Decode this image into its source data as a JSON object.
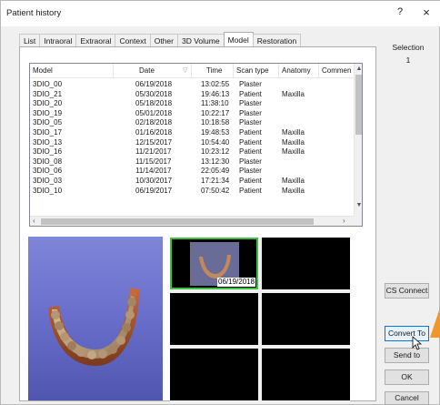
{
  "window": {
    "title": "Patient history",
    "help": "?",
    "close": "×"
  },
  "tabs": [
    {
      "label": "List"
    },
    {
      "label": "Intraoral"
    },
    {
      "label": "Extraoral"
    },
    {
      "label": "Context"
    },
    {
      "label": "Other"
    },
    {
      "label": "3D Volume"
    },
    {
      "label": "Model",
      "active": true
    },
    {
      "label": "Restoration"
    }
  ],
  "selection": {
    "label": "Selection",
    "value": "1"
  },
  "table": {
    "columns": [
      "Model",
      "Date",
      "Time",
      "Scan type",
      "Anatomy",
      "Commen"
    ],
    "rows": [
      [
        "3DIO_00",
        "06/19/2018",
        "13:02:55",
        "Plaster",
        ""
      ],
      [
        "3DIO_21",
        "05/30/2018",
        "19:46:13",
        "Patient",
        "Maxilla"
      ],
      [
        "3DIO_20",
        "05/18/2018",
        "11:38:10",
        "Plaster",
        ""
      ],
      [
        "3DIO_19",
        "05/01/2018",
        "10:22:17",
        "Plaster",
        ""
      ],
      [
        "3DIO_05",
        "02/18/2018",
        "10:18:58",
        "Plaster",
        ""
      ],
      [
        "3DIO_17",
        "01/16/2018",
        "19:48:53",
        "Patient",
        "Maxilla"
      ],
      [
        "3DIO_13",
        "12/15/2017",
        "10:54:40",
        "Patient",
        "Maxilla"
      ],
      [
        "3DIO_16",
        "11/21/2017",
        "10:23:12",
        "Patient",
        "Maxilla"
      ],
      [
        "3DIO_08",
        "11/15/2017",
        "13:12:30",
        "Plaster",
        ""
      ],
      [
        "3DIO_06",
        "11/14/2017",
        "22:05:49",
        "Plaster",
        ""
      ],
      [
        "3DIO_03",
        "10/30/2017",
        "17:21:34",
        "Patient",
        "Maxilla"
      ],
      [
        "3DIO_10",
        "06/19/2017",
        "07:50:42",
        "Patient",
        "Maxilla"
      ]
    ]
  },
  "thumbnails": {
    "selected_date": "06/19/2018"
  },
  "buttons": {
    "cs_connect": "CS Connect",
    "convert_to": "Convert To",
    "send_to": "Send to",
    "ok": "OK",
    "cancel": "Cancel"
  },
  "icons": {
    "sort": "sort-arrow-icon",
    "scroll_up": "scroll-up-icon",
    "scroll_down": "scroll-down-icon",
    "scroll_left": "scroll-left-icon",
    "scroll_right": "scroll-right-icon"
  },
  "colors": {
    "selected_thumb_border": "#3fbf3f",
    "preview_bg": "#6b70cc",
    "focus_border": "#0078d7",
    "marker": "#f0962a"
  }
}
